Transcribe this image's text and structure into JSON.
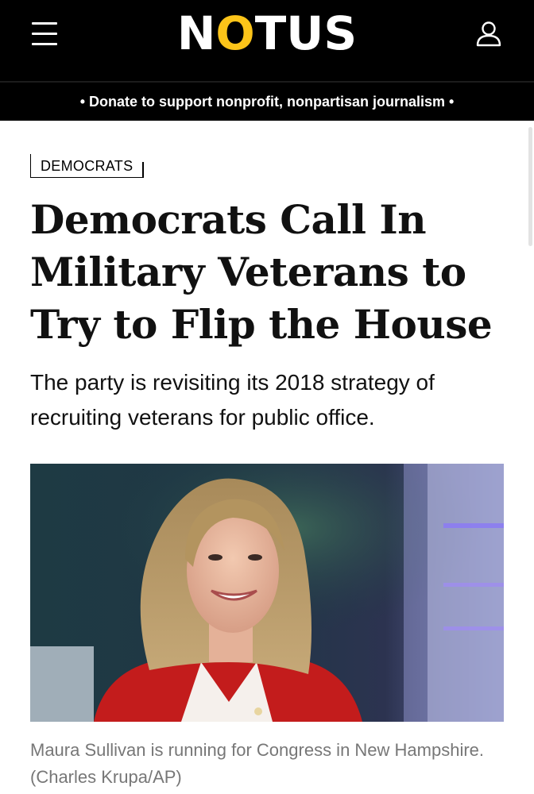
{
  "header": {
    "logo_pre": "N",
    "logo_o": "O",
    "logo_post": "TUS",
    "menu_icon": "hamburger-menu-icon",
    "account_icon": "user-account-icon",
    "accent_color": "#fcc419"
  },
  "donate_banner": {
    "text": "• Donate to support nonprofit, nonpartisan journalism •"
  },
  "article": {
    "category": "DEMOCRATS",
    "headline": "Democrats Call In Military Veterans to Try to Flip the House",
    "dek": "The party is revisiting its 2018 strategy of recruiting veterans for public office.",
    "photo_caption": "Maura Sullivan is running for Congress in New Hampshire. (Charles Krupa/AP)"
  }
}
